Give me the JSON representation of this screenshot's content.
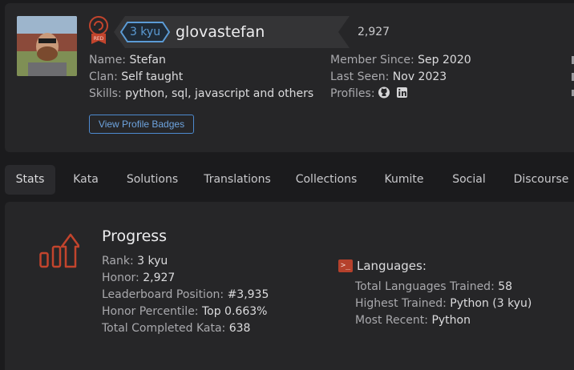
{
  "profile": {
    "rank_badge_label": "RED",
    "rank": "3 kyu",
    "username": "glovastefan",
    "honor": "2,927",
    "left_info": [
      {
        "key": "Name:",
        "value": "Stefan"
      },
      {
        "key": "Clan:",
        "value": "Self taught"
      },
      {
        "key": "Skills:",
        "value": "python, sql, javascript and others"
      }
    ],
    "right_info": [
      {
        "key": "Member Since:",
        "value": "Sep 2020"
      },
      {
        "key": "Last Seen:",
        "value": "Nov 2023"
      },
      {
        "key": "Profiles:",
        "value": ""
      }
    ],
    "profile_icons": [
      "github-icon",
      "linkedin-icon"
    ],
    "badges_button": "View Profile Badges"
  },
  "tabs": [
    {
      "label": "Stats",
      "active": true
    },
    {
      "label": "Kata",
      "active": false
    },
    {
      "label": "Solutions",
      "active": false
    },
    {
      "label": "Translations",
      "active": false
    },
    {
      "label": "Collections",
      "active": false
    },
    {
      "label": "Kumite",
      "active": false
    },
    {
      "label": "Social",
      "active": false
    },
    {
      "label": "Discourse",
      "active": false
    }
  ],
  "progress": {
    "title": "Progress",
    "stats": [
      {
        "key": "Rank:",
        "value": "3 kyu"
      },
      {
        "key": "Honor:",
        "value": "2,927"
      },
      {
        "key": "Leaderboard Position:",
        "value": "#3,935"
      },
      {
        "key": "Honor Percentile:",
        "value": "Top 0.663%"
      },
      {
        "key": "Total Completed Kata:",
        "value": "638"
      }
    ]
  },
  "languages": {
    "title": "Languages:",
    "stats": [
      {
        "key": "Total Languages Trained:",
        "value": "58"
      },
      {
        "key": "Highest Trained:",
        "value": "Python (3 kyu)"
      },
      {
        "key": "Most Recent:",
        "value": "Python"
      }
    ]
  },
  "colors": {
    "accent_red": "#b5412c",
    "rank_blue": "#5b9bd5",
    "card_bg": "#262628",
    "page_bg": "#1b1b1d"
  }
}
